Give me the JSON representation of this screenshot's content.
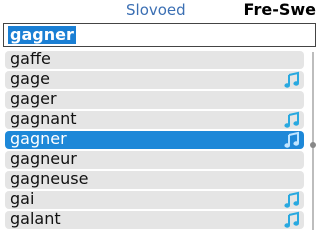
{
  "header": {
    "title": "Slovoed",
    "dictionary": "Fre-Swe"
  },
  "search": {
    "value": "gagner"
  },
  "words": [
    {
      "text": "gaffe",
      "audio": false,
      "selected": false
    },
    {
      "text": "gage",
      "audio": true,
      "selected": false
    },
    {
      "text": "gager",
      "audio": false,
      "selected": false
    },
    {
      "text": "gagnant",
      "audio": true,
      "selected": false
    },
    {
      "text": "gagner",
      "audio": true,
      "selected": true
    },
    {
      "text": "gagneur",
      "audio": false,
      "selected": false
    },
    {
      "text": "gagneuse",
      "audio": false,
      "selected": false
    },
    {
      "text": "gai",
      "audio": true,
      "selected": false
    },
    {
      "text": "galant",
      "audio": true,
      "selected": false
    }
  ],
  "icons": {
    "audio": "music-note-icon"
  },
  "colors": {
    "accent": "#1e88d8",
    "title": "#3b6fb3",
    "note": "#29a9e0",
    "row_bg": "#e5e5e5"
  }
}
